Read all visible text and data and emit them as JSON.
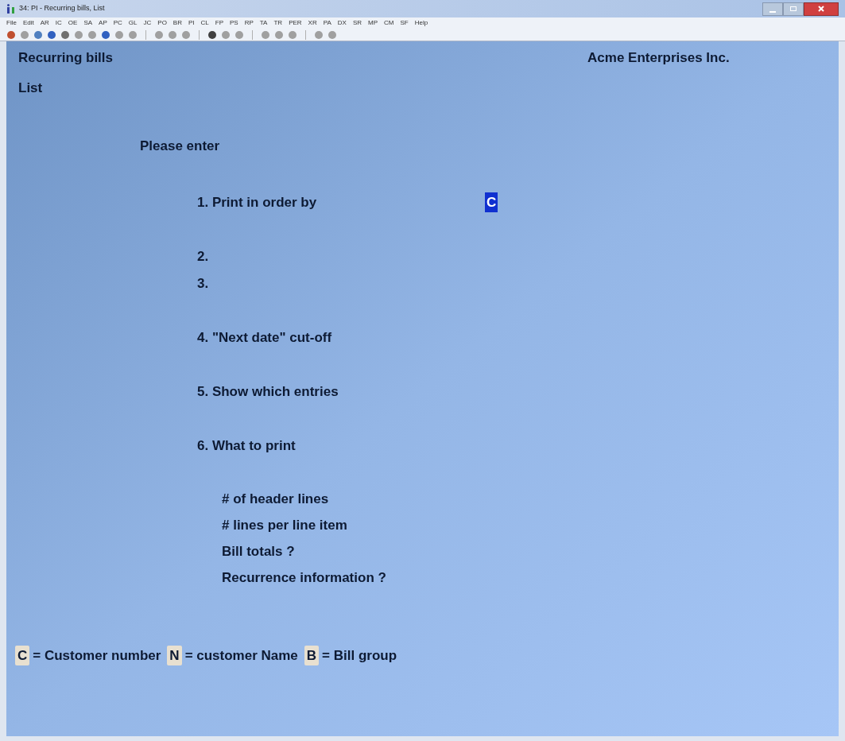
{
  "window": {
    "title": "34: PI - Recurring bills, List"
  },
  "menu": [
    "File",
    "Edit",
    "AR",
    "IC",
    "OE",
    "SA",
    "AP",
    "PC",
    "GL",
    "JC",
    "PO",
    "BR",
    "PI",
    "CL",
    "FP",
    "PS",
    "RP",
    "TA",
    "TR",
    "PER",
    "XR",
    "PA",
    "DX",
    "SR",
    "MP",
    "CM",
    "SF",
    "Help"
  ],
  "screen": {
    "title": "Recurring bills",
    "company": "Acme Enterprises Inc.",
    "subtitle": "List",
    "prompt": "Please enter",
    "fields": [
      {
        "label": "1. Print in order by",
        "value": "C",
        "selected": true
      },
      {
        "label": "2."
      },
      {
        "label": "3."
      },
      {
        "label": "4. \"Next date\" cut-off"
      },
      {
        "label": "5. Show which entries"
      },
      {
        "label": "6. What to print"
      }
    ],
    "sub_fields": [
      "# of header lines",
      "# lines per line item",
      "Bill totals ?",
      "Recurrence information ?"
    ],
    "legend": [
      {
        "key": "C",
        "text": "= Customer number"
      },
      {
        "key": "N",
        "text": "= customer Name"
      },
      {
        "key": "B",
        "text": "= Bill group"
      }
    ]
  }
}
